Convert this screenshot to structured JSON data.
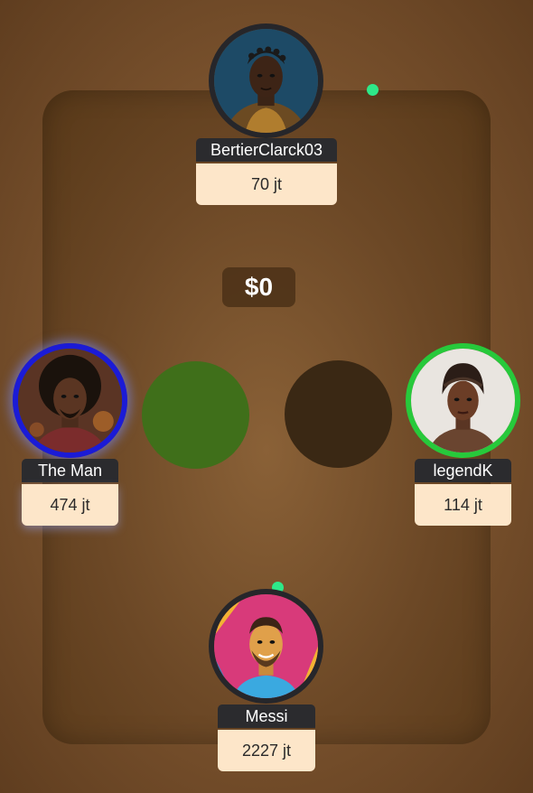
{
  "pot": {
    "amount": "$0"
  },
  "players": {
    "top": {
      "name": "BertierClarck03",
      "stack": "70 jt",
      "avatar": "warrior-portrait-icon"
    },
    "left": {
      "name": "The Man",
      "stack": "474 jt",
      "avatar": "curly-hair-man-portrait-icon",
      "highlight": "#1b1bd6"
    },
    "right": {
      "name": "legendK",
      "stack": "114 jt",
      "avatar": "headwrap-woman-portrait-icon",
      "highlight": "#27c93b"
    },
    "bottom": {
      "name": "Messi",
      "stack": "2227 jt",
      "avatar": "soccer-player-portrait-icon"
    }
  },
  "colors": {
    "table": "#6c4826",
    "active_seat": "#3f6f1a",
    "empty_seat": "#3a2814",
    "online_dot": "#2ee889"
  }
}
